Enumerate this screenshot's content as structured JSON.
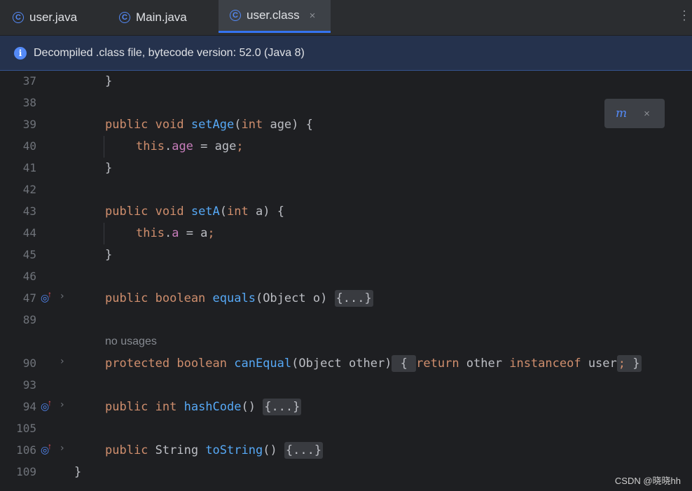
{
  "tabs": [
    {
      "label": "user.java",
      "icon": "class-icon",
      "active": false
    },
    {
      "label": "Main.java",
      "icon": "class-icon",
      "active": false
    },
    {
      "label": "user.class",
      "icon": "class-icon",
      "active": true
    }
  ],
  "tab_close": "×",
  "tab_more": "⋮",
  "banner": {
    "text": "Decompiled .class file, bytecode version: 52.0 (Java 8)",
    "icon": "info-icon"
  },
  "popup": {
    "icon_label": "m",
    "close": "×"
  },
  "lines": {
    "l37": "37",
    "l38": "38",
    "l39": "39",
    "l40": "40",
    "l41": "41",
    "l42": "42",
    "l43": "43",
    "l44": "44",
    "l45": "45",
    "l46": "46",
    "l47": "47",
    "l89": "89",
    "l90": "90",
    "l93": "93",
    "l94": "94",
    "l105": "105",
    "l106": "106",
    "l109": "109"
  },
  "hint_no_usages": "no usages",
  "fold_placeholder": "{...}",
  "watermark": "CSDN @晓晓hh",
  "colors": {
    "keyword": "#cf8e6d",
    "function": "#56a8f5",
    "field": "#c77dbb",
    "accent": "#3574f0"
  }
}
